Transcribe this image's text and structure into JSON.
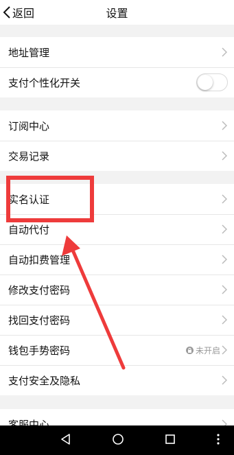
{
  "header": {
    "back_label": "返回",
    "title": "设置"
  },
  "group1": [
    {
      "label": "地址管理"
    },
    {
      "label": "支付个性化开关"
    }
  ],
  "group2": [
    {
      "label": "订阅中心"
    },
    {
      "label": "交易记录"
    }
  ],
  "group3": [
    {
      "label": "实名认证"
    },
    {
      "label": "自动代付"
    },
    {
      "label": "自动扣费管理"
    },
    {
      "label": "修改支付密码"
    },
    {
      "label": "找回支付密码"
    },
    {
      "label": "钱包手势密码",
      "status": "未开启"
    },
    {
      "label": "支付安全及隐私"
    }
  ],
  "group4": [
    {
      "label": "客服中心"
    }
  ],
  "toggle": {
    "state": "off"
  },
  "colors": {
    "annotation_red": "#ee3b3b",
    "nav_bar": "#000000",
    "background": "#f2f2f2"
  },
  "icons": [
    "chevron-left-icon",
    "chevron-right-icon",
    "lock-icon",
    "nav-back-icon",
    "nav-home-icon",
    "nav-recents-icon",
    "nav-menu-icon"
  ]
}
